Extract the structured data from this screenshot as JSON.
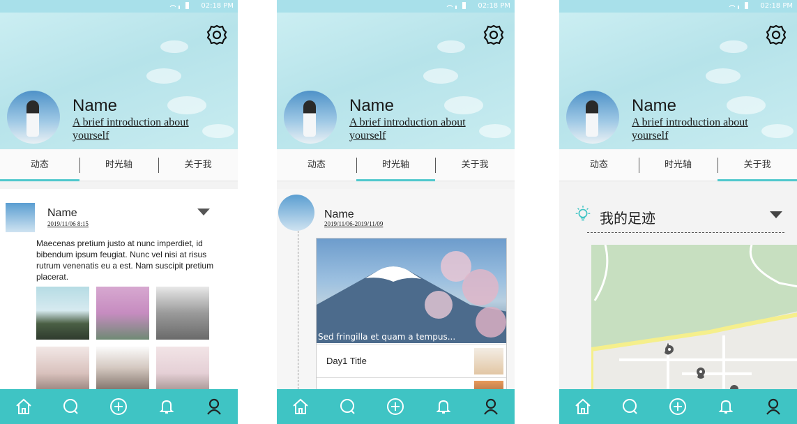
{
  "status_bar": {
    "time": "02:18 PM"
  },
  "profile": {
    "name": "Name",
    "intro": "A brief introduction about yourself"
  },
  "tabs": [
    "动态",
    "时光轴",
    "关于我"
  ],
  "post": {
    "name": "Name",
    "date": "2019/11/06 8:15",
    "text": "Maecenas pretium justo at nunc imperdiet, id bibendum ipsum feugiat. Nunc vel nisi at risus rutrum venenatis eu a est. Nam suscipit pretium placerat."
  },
  "timeline": {
    "name": "Name",
    "date": "2019/11/06-2019/11/09",
    "caption": "Sed fringilla et quam a tempus...",
    "day1_title": "Day1 Title"
  },
  "footprint": {
    "title": "我的足迹"
  },
  "nav_icons": [
    "home-icon",
    "search-icon",
    "add-icon",
    "bell-icon",
    "profile-icon"
  ],
  "colors": {
    "accent": "#3fc4c4",
    "header_bg": "#b6e3ea",
    "tab_underline": "#4fc8cc"
  }
}
